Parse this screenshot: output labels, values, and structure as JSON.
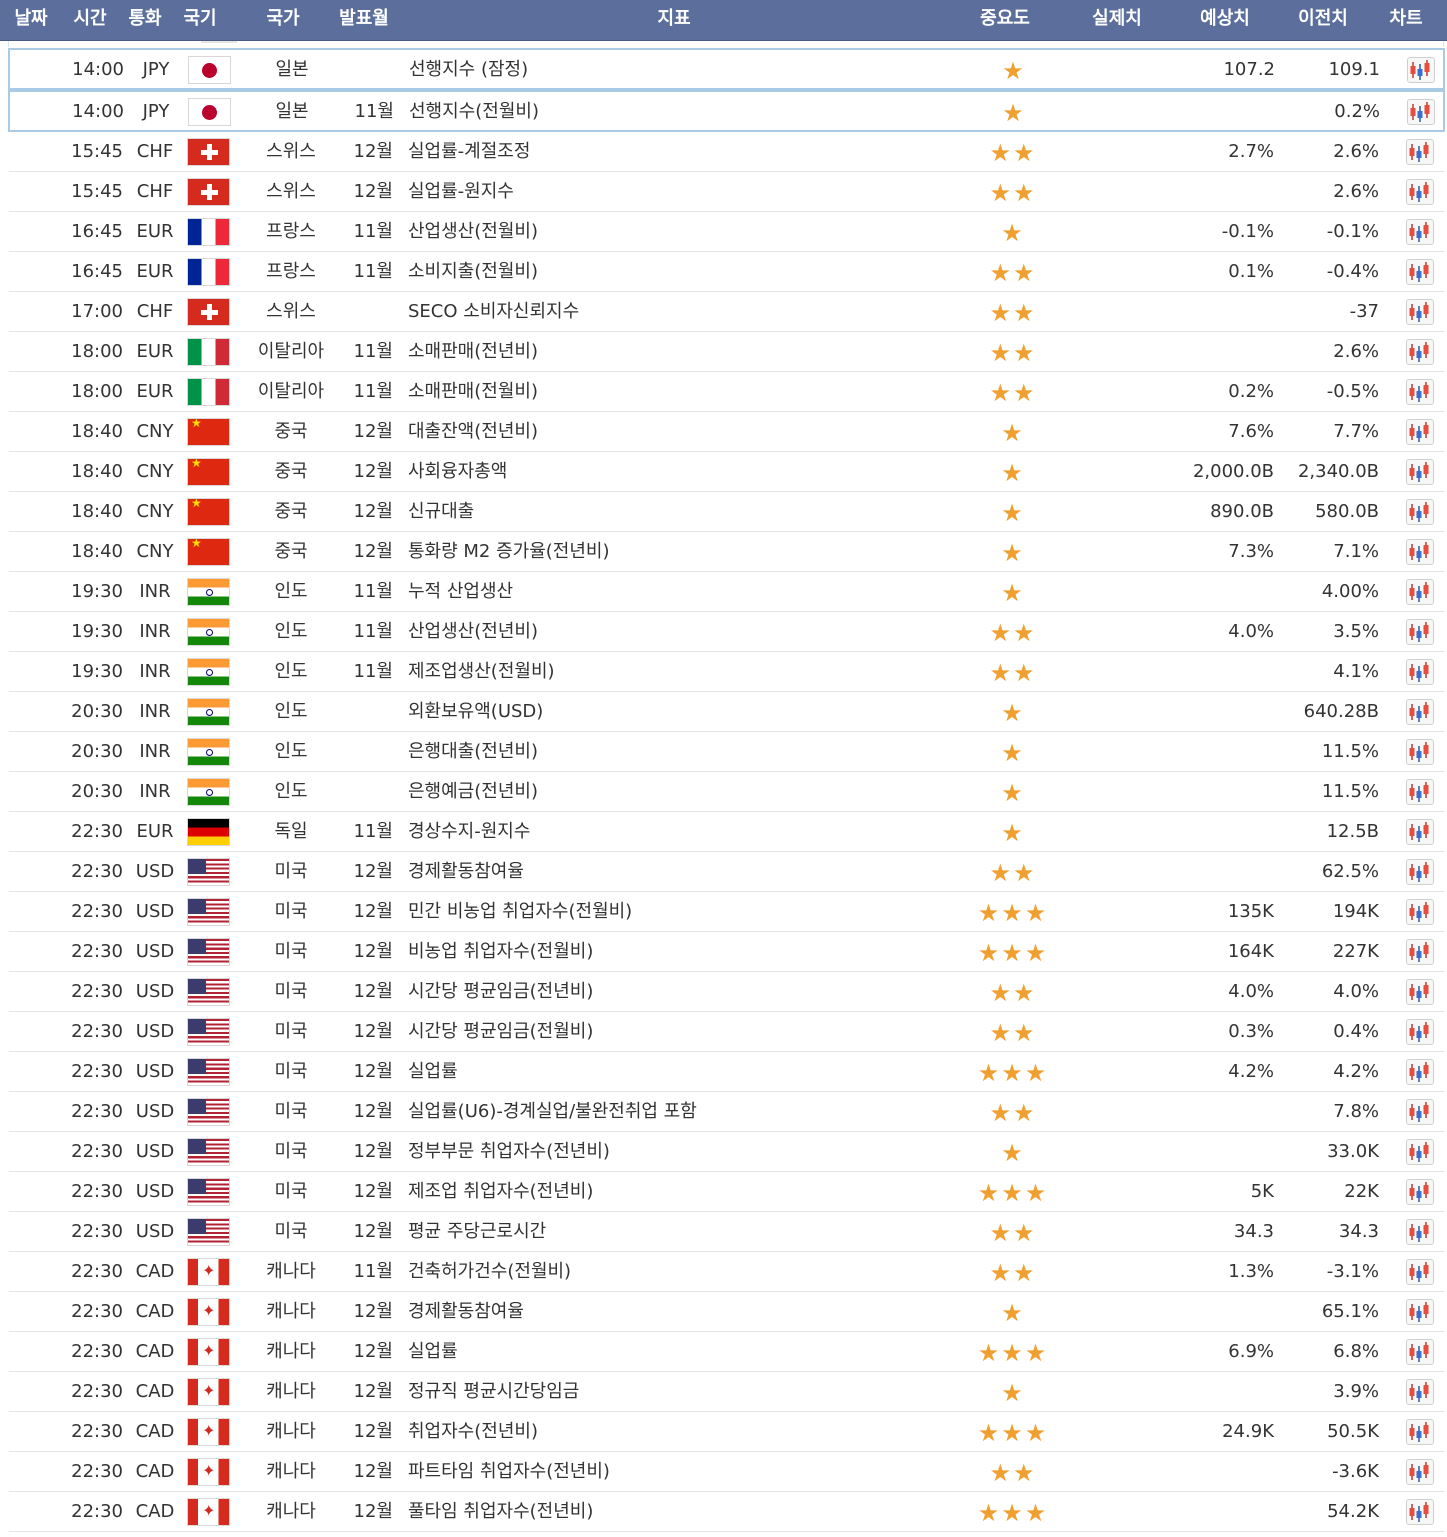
{
  "header": {
    "date": "날짜",
    "time": "시간",
    "currency": "통화",
    "flag": "국기",
    "country": "국가",
    "month": "발표월",
    "indicator": "지표",
    "importance": "중요도",
    "actual": "실제치",
    "forecast": "예상치",
    "previous": "이전치",
    "chart": "차트"
  },
  "colors": {
    "header_bg": "#5b6e9c",
    "star": "#f0a030",
    "highlight_border": "#a9cbe6"
  },
  "rows": [
    {
      "time": "14:00",
      "currency": "JPY",
      "flag": "jp",
      "country": "일본",
      "month": "",
      "indicator": "선행지수 (잠정)",
      "stars": 1,
      "forecast": "107.2",
      "previous": "109.1",
      "highlight": true
    },
    {
      "time": "14:00",
      "currency": "JPY",
      "flag": "jp",
      "country": "일본",
      "month": "11월",
      "indicator": "선행지수(전월비)",
      "stars": 1,
      "forecast": "",
      "previous": "0.2%",
      "highlight": true
    },
    {
      "time": "15:45",
      "currency": "CHF",
      "flag": "ch",
      "country": "스위스",
      "month": "12월",
      "indicator": "실업률-계절조정",
      "stars": 2,
      "forecast": "2.7%",
      "previous": "2.6%"
    },
    {
      "time": "15:45",
      "currency": "CHF",
      "flag": "ch",
      "country": "스위스",
      "month": "12월",
      "indicator": "실업률-원지수",
      "stars": 2,
      "forecast": "",
      "previous": "2.6%"
    },
    {
      "time": "16:45",
      "currency": "EUR",
      "flag": "fr",
      "country": "프랑스",
      "month": "11월",
      "indicator": "산업생산(전월비)",
      "stars": 1,
      "forecast": "-0.1%",
      "previous": "-0.1%"
    },
    {
      "time": "16:45",
      "currency": "EUR",
      "flag": "fr",
      "country": "프랑스",
      "month": "11월",
      "indicator": "소비지출(전월비)",
      "stars": 2,
      "forecast": "0.1%",
      "previous": "-0.4%"
    },
    {
      "time": "17:00",
      "currency": "CHF",
      "flag": "ch",
      "country": "스위스",
      "month": "",
      "indicator": "SECO 소비자신뢰지수",
      "stars": 2,
      "forecast": "",
      "previous": "-37"
    },
    {
      "time": "18:00",
      "currency": "EUR",
      "flag": "it",
      "country": "이탈리아",
      "month": "11월",
      "indicator": "소매판매(전년비)",
      "stars": 2,
      "forecast": "",
      "previous": "2.6%"
    },
    {
      "time": "18:00",
      "currency": "EUR",
      "flag": "it",
      "country": "이탈리아",
      "month": "11월",
      "indicator": "소매판매(전월비)",
      "stars": 2,
      "forecast": "0.2%",
      "previous": "-0.5%"
    },
    {
      "time": "18:40",
      "currency": "CNY",
      "flag": "cn",
      "country": "중국",
      "month": "12월",
      "indicator": "대출잔액(전년비)",
      "stars": 1,
      "forecast": "7.6%",
      "previous": "7.7%"
    },
    {
      "time": "18:40",
      "currency": "CNY",
      "flag": "cn",
      "country": "중국",
      "month": "12월",
      "indicator": "사회융자총액",
      "stars": 1,
      "forecast": "2,000.0B",
      "previous": "2,340.0B"
    },
    {
      "time": "18:40",
      "currency": "CNY",
      "flag": "cn",
      "country": "중국",
      "month": "12월",
      "indicator": "신규대출",
      "stars": 1,
      "forecast": "890.0B",
      "previous": "580.0B"
    },
    {
      "time": "18:40",
      "currency": "CNY",
      "flag": "cn",
      "country": "중국",
      "month": "12월",
      "indicator": "통화량 M2 증가율(전년비)",
      "stars": 1,
      "forecast": "7.3%",
      "previous": "7.1%"
    },
    {
      "time": "19:30",
      "currency": "INR",
      "flag": "in",
      "country": "인도",
      "month": "11월",
      "indicator": "누적 산업생산",
      "stars": 1,
      "forecast": "",
      "previous": "4.00%"
    },
    {
      "time": "19:30",
      "currency": "INR",
      "flag": "in",
      "country": "인도",
      "month": "11월",
      "indicator": "산업생산(전년비)",
      "stars": 2,
      "forecast": "4.0%",
      "previous": "3.5%"
    },
    {
      "time": "19:30",
      "currency": "INR",
      "flag": "in",
      "country": "인도",
      "month": "11월",
      "indicator": "제조업생산(전월비)",
      "stars": 2,
      "forecast": "",
      "previous": "4.1%"
    },
    {
      "time": "20:30",
      "currency": "INR",
      "flag": "in",
      "country": "인도",
      "month": "",
      "indicator": "외환보유액(USD)",
      "stars": 1,
      "forecast": "",
      "previous": "640.28B"
    },
    {
      "time": "20:30",
      "currency": "INR",
      "flag": "in",
      "country": "인도",
      "month": "",
      "indicator": "은행대출(전년비)",
      "stars": 1,
      "forecast": "",
      "previous": "11.5%"
    },
    {
      "time": "20:30",
      "currency": "INR",
      "flag": "in",
      "country": "인도",
      "month": "",
      "indicator": "은행예금(전년비)",
      "stars": 1,
      "forecast": "",
      "previous": "11.5%"
    },
    {
      "time": "22:30",
      "currency": "EUR",
      "flag": "de",
      "country": "독일",
      "month": "11월",
      "indicator": "경상수지-원지수",
      "stars": 1,
      "forecast": "",
      "previous": "12.5B"
    },
    {
      "time": "22:30",
      "currency": "USD",
      "flag": "us",
      "country": "미국",
      "month": "12월",
      "indicator": "경제활동참여율",
      "stars": 2,
      "forecast": "",
      "previous": "62.5%"
    },
    {
      "time": "22:30",
      "currency": "USD",
      "flag": "us",
      "country": "미국",
      "month": "12월",
      "indicator": "민간 비농업 취업자수(전월비)",
      "stars": 3,
      "forecast": "135K",
      "previous": "194K"
    },
    {
      "time": "22:30",
      "currency": "USD",
      "flag": "us",
      "country": "미국",
      "month": "12월",
      "indicator": "비농업 취업자수(전월비)",
      "stars": 3,
      "forecast": "164K",
      "previous": "227K"
    },
    {
      "time": "22:30",
      "currency": "USD",
      "flag": "us",
      "country": "미국",
      "month": "12월",
      "indicator": "시간당 평균임금(전년비)",
      "stars": 2,
      "forecast": "4.0%",
      "previous": "4.0%"
    },
    {
      "time": "22:30",
      "currency": "USD",
      "flag": "us",
      "country": "미국",
      "month": "12월",
      "indicator": "시간당 평균임금(전월비)",
      "stars": 2,
      "forecast": "0.3%",
      "previous": "0.4%"
    },
    {
      "time": "22:30",
      "currency": "USD",
      "flag": "us",
      "country": "미국",
      "month": "12월",
      "indicator": "실업률",
      "stars": 3,
      "forecast": "4.2%",
      "previous": "4.2%"
    },
    {
      "time": "22:30",
      "currency": "USD",
      "flag": "us",
      "country": "미국",
      "month": "12월",
      "indicator": "실업률(U6)-경계실업/불완전취업 포함",
      "stars": 2,
      "forecast": "",
      "previous": "7.8%"
    },
    {
      "time": "22:30",
      "currency": "USD",
      "flag": "us",
      "country": "미국",
      "month": "12월",
      "indicator": "정부부문 취업자수(전년비)",
      "stars": 1,
      "forecast": "",
      "previous": "33.0K"
    },
    {
      "time": "22:30",
      "currency": "USD",
      "flag": "us",
      "country": "미국",
      "month": "12월",
      "indicator": "제조업 취업자수(전년비)",
      "stars": 3,
      "forecast": "5K",
      "previous": "22K"
    },
    {
      "time": "22:30",
      "currency": "USD",
      "flag": "us",
      "country": "미국",
      "month": "12월",
      "indicator": "평균 주당근로시간",
      "stars": 2,
      "forecast": "34.3",
      "previous": "34.3"
    },
    {
      "time": "22:30",
      "currency": "CAD",
      "flag": "ca",
      "country": "캐나다",
      "month": "11월",
      "indicator": "건축허가건수(전월비)",
      "stars": 2,
      "forecast": "1.3%",
      "previous": "-3.1%"
    },
    {
      "time": "22:30",
      "currency": "CAD",
      "flag": "ca",
      "country": "캐나다",
      "month": "12월",
      "indicator": "경제활동참여율",
      "stars": 1,
      "forecast": "",
      "previous": "65.1%"
    },
    {
      "time": "22:30",
      "currency": "CAD",
      "flag": "ca",
      "country": "캐나다",
      "month": "12월",
      "indicator": "실업률",
      "stars": 3,
      "forecast": "6.9%",
      "previous": "6.8%"
    },
    {
      "time": "22:30",
      "currency": "CAD",
      "flag": "ca",
      "country": "캐나다",
      "month": "12월",
      "indicator": "정규직 평균시간당임금",
      "stars": 1,
      "forecast": "",
      "previous": "3.9%"
    },
    {
      "time": "22:30",
      "currency": "CAD",
      "flag": "ca",
      "country": "캐나다",
      "month": "12월",
      "indicator": "취업자수(전년비)",
      "stars": 3,
      "forecast": "24.9K",
      "previous": "50.5K"
    },
    {
      "time": "22:30",
      "currency": "CAD",
      "flag": "ca",
      "country": "캐나다",
      "month": "12월",
      "indicator": "파트타임 취업자수(전년비)",
      "stars": 2,
      "forecast": "",
      "previous": "-3.6K"
    },
    {
      "time": "22:30",
      "currency": "CAD",
      "flag": "ca",
      "country": "캐나다",
      "month": "12월",
      "indicator": "풀타임 취업자수(전년비)",
      "stars": 3,
      "forecast": "",
      "previous": "54.2K"
    }
  ]
}
